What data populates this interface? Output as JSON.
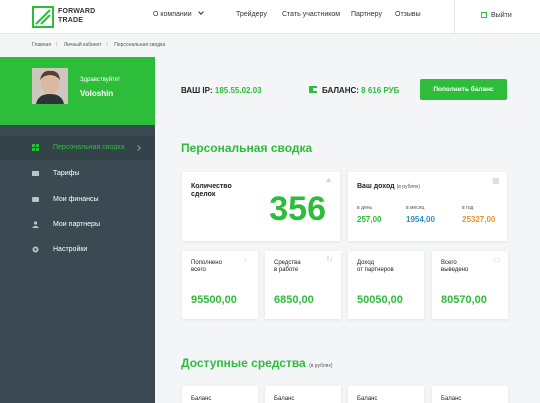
{
  "header": {
    "logo_line1": "FORWARD",
    "logo_line2": "TRADE",
    "nav": [
      "О компании",
      "Трейдеру",
      "Стать участником",
      "Партнеру",
      "Отзывы"
    ],
    "logout": "Выйти"
  },
  "breadcrumb": [
    "Главная",
    "Личный кабинет",
    "Персональная сводка"
  ],
  "user": {
    "greeting": "Здравствуйте!",
    "name": "Voloshin"
  },
  "sidebar": {
    "items": [
      {
        "label": "Персональная сводка",
        "icon": "grid-icon",
        "active": true
      },
      {
        "label": "Тарифы",
        "icon": "tariff-icon",
        "active": false
      },
      {
        "label": "Мои финансы",
        "icon": "wallet-icon",
        "active": false
      },
      {
        "label": "Мои партнеры",
        "icon": "partners-icon",
        "active": false
      },
      {
        "label": "Настройки",
        "icon": "gear-icon",
        "active": false
      }
    ]
  },
  "topbar": {
    "ip_label": "ВАШ IP:",
    "ip_value": "185.55.02.03",
    "balance_label": "БАЛАНС:",
    "balance_value": "8 616 РУБ",
    "topup_button": "Пополнить баланс"
  },
  "summary": {
    "title": "Персональная сводка",
    "deals_label_1": "Количество",
    "deals_label_2": "сделок",
    "deals_value": "356",
    "income_title": "Ваш доход",
    "income_unit": "(в рублях)",
    "income": [
      {
        "label": "в день",
        "value": "257,00",
        "color": "#2ebd3b"
      },
      {
        "label": "в месяц",
        "value": "1954,00",
        "color": "#2a8fc9"
      },
      {
        "label": "в год",
        "value": "25327,00",
        "color": "#f0932b"
      }
    ],
    "stats": [
      {
        "label1": "Пополнено",
        "label2": "всего",
        "value": "95500,00"
      },
      {
        "label1": "Средства",
        "label2": "в работе",
        "value": "6850,00"
      },
      {
        "label1": "Доход",
        "label2": "от партнеров",
        "value": "50050,00"
      },
      {
        "label1": "Всего",
        "label2": "выведено",
        "value": "80570,00"
      }
    ]
  },
  "available": {
    "title": "Доступные средства",
    "unit": "(в рублях)",
    "cards": [
      "Баланс",
      "Баланс",
      "Баланс",
      "Баланс"
    ]
  }
}
